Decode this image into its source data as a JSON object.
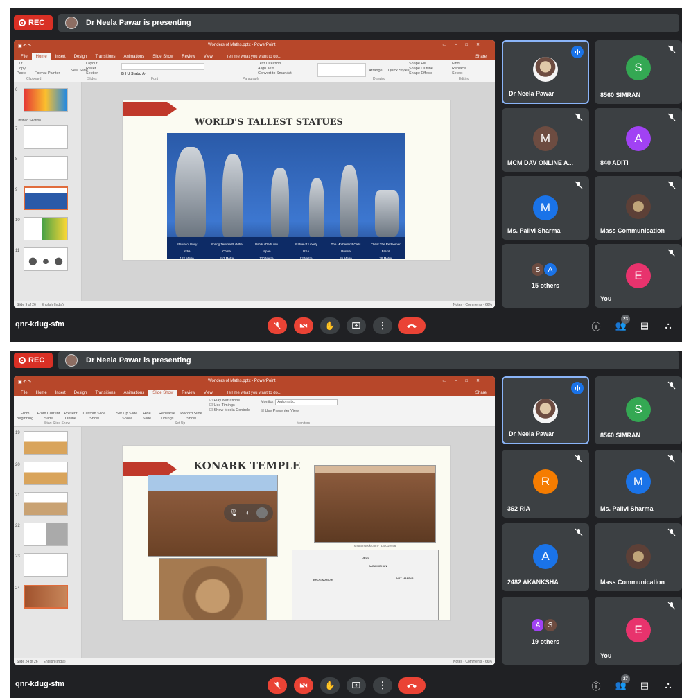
{
  "frames": [
    {
      "rec_label": "REC",
      "presenting": "Dr Neela Pawar is presenting",
      "ppt": {
        "title": "Wonders of Maths.pptx - PowerPoint",
        "active_tab": "Home",
        "tabs": [
          "File",
          "Home",
          "Insert",
          "Design",
          "Transitions",
          "Animations",
          "Slide Show",
          "Review",
          "View"
        ],
        "tell_me": "Tell me what you want to do...",
        "share": "Share",
        "ribbon": {
          "clipboard": "Clipboard",
          "cut": "Cut",
          "copy": "Copy",
          "paste": "Paste",
          "format_painter": "Format Painter",
          "new_slide": "New Slide",
          "layout": "Layout",
          "reset": "Reset",
          "section": "Section",
          "slides": "Slides",
          "font": "Font",
          "paragraph": "Paragraph",
          "text_direction": "Text Direction",
          "align_text": "Align Text",
          "convert_smartart": "Convert to SmartArt",
          "drawing": "Drawing",
          "arrange": "Arrange",
          "quick_styles": "Quick Styles",
          "shape_fill": "Shape Fill",
          "shape_outline": "Shape Outline",
          "shape_effects": "Shape Effects",
          "editing": "Editing",
          "find": "Find",
          "replace": "Replace",
          "select": "Select"
        },
        "section_label": "Untitled Section",
        "thumb_numbers": [
          "6",
          "7",
          "8",
          "9",
          "10",
          "11"
        ],
        "status_slide": "Slide 9 of 26",
        "status_lang": "English (India)",
        "status_notes": "Notes",
        "status_comments": "Comments",
        "zoom": "66%",
        "slide": {
          "title": "WORLD'S TALLEST STATUES",
          "statues": [
            {
              "name": "Statue of Unity",
              "place": "India",
              "height": "182 Metre"
            },
            {
              "name": "Spring Temple Buddha",
              "place": "China",
              "height": "153 Metre"
            },
            {
              "name": "Ushiku Daibutsu",
              "place": "Japan",
              "height": "120 Metre"
            },
            {
              "name": "Statue of Liberty",
              "place": "USA",
              "height": "93 Metre"
            },
            {
              "name": "The Motherland Calls",
              "place": "Russia",
              "height": "85 Metre"
            },
            {
              "name": "Christ The Redeemer",
              "place": "Brazil",
              "height": "38 Metre"
            }
          ]
        }
      },
      "tiles": [
        {
          "name": "Dr Neela Pawar",
          "type": "photo",
          "speaking": true
        },
        {
          "name": "8560 SIMRAN",
          "letter": "S",
          "color": "#34a853"
        },
        {
          "name": "MCM DAV ONLINE A...",
          "letter": "M",
          "color": "#6d4c41"
        },
        {
          "name": "840 ADITI",
          "letter": "A",
          "color": "#a142f4"
        },
        {
          "name": "Ms. Pallvi Sharma",
          "letter": "M",
          "color": "#1a73e8"
        },
        {
          "name": "Mass Communication",
          "type": "photo"
        },
        {
          "name": "15 others",
          "type": "others",
          "letters": [
            "S",
            "A"
          ],
          "colors": [
            "#6d4c41",
            "#1a73e8"
          ]
        },
        {
          "name": "You",
          "letter": "E",
          "color": "#e8336d"
        }
      ],
      "meeting_code": "qnr-kdug-sfm",
      "participants_count": "23"
    },
    {
      "rec_label": "REC",
      "presenting": "Dr Neela Pawar is presenting",
      "ppt": {
        "title": "Wonders of Maths.pptx - PowerPoint",
        "active_tab": "Slide Show",
        "tabs": [
          "File",
          "Home",
          "Insert",
          "Design",
          "Transitions",
          "Animations",
          "Slide Show",
          "Review",
          "View"
        ],
        "tell_me": "Tell me what you want to do...",
        "share": "Share",
        "ribbon": {
          "from_beginning": "From Beginning",
          "from_current": "From Current Slide",
          "present_online": "Present Online",
          "custom_show": "Custom Slide Show",
          "start_group": "Start Slide Show",
          "setup_show": "Set Up Slide Show",
          "hide_slide": "Hide Slide",
          "rehearse": "Rehearse Timings",
          "record": "Record Slide Show",
          "setup_group": "Set Up",
          "play_narrations": "Play Narrations",
          "use_timings": "Use Timings",
          "show_media": "Show Media Controls",
          "monitor": "Monitor:",
          "monitor_value": "Automatic",
          "presenter_view": "Use Presenter View",
          "monitors_group": "Monitors"
        },
        "thumb_numbers": [
          "19",
          "20",
          "21",
          "22",
          "23",
          "24"
        ],
        "status_slide": "Slide 24 of 26",
        "status_lang": "English (India)",
        "status_notes": "Notes",
        "status_comments": "Comments",
        "zoom": "66%",
        "slide": {
          "title": "KONARK TEMPLE",
          "credit": "shutterstock.com · 530019496",
          "labels": [
            "DEUL",
            "JAGA MOHAN",
            "BHOG MANDIR",
            "NAT MANDIR"
          ]
        }
      },
      "tiles": [
        {
          "name": "Dr Neela Pawar",
          "type": "photo",
          "speaking": true
        },
        {
          "name": "8560 SIMRAN",
          "letter": "S",
          "color": "#34a853"
        },
        {
          "name": "362 RIA",
          "letter": "R",
          "color": "#f57c00"
        },
        {
          "name": "Ms. Pallvi Sharma",
          "letter": "M",
          "color": "#1a73e8"
        },
        {
          "name": "2482 AKANKSHA",
          "letter": "A",
          "color": "#1a73e8"
        },
        {
          "name": "Mass Communication",
          "type": "photo"
        },
        {
          "name": "19 others",
          "type": "others",
          "letters": [
            "A",
            "S"
          ],
          "colors": [
            "#a142f4",
            "#6d4c41"
          ]
        },
        {
          "name": "You",
          "letter": "E",
          "color": "#e8336d"
        }
      ],
      "meeting_code": "qnr-kdug-sfm",
      "participants_count": "27"
    }
  ],
  "icons": {
    "mic_off": "mic-off-icon",
    "cam_off": "camera-off-icon",
    "hand": "raise-hand-icon",
    "present": "present-screen-icon",
    "more": "more-options-icon",
    "end": "end-call-icon",
    "info": "info-icon",
    "people": "people-icon",
    "chat": "chat-icon",
    "activities": "activities-icon"
  },
  "colors": {
    "meet_bg": "#202124",
    "tile_bg": "#3c4043",
    "danger": "#ea4335",
    "ppt_accent": "#b7472a",
    "active_border": "#8ab4f8"
  }
}
